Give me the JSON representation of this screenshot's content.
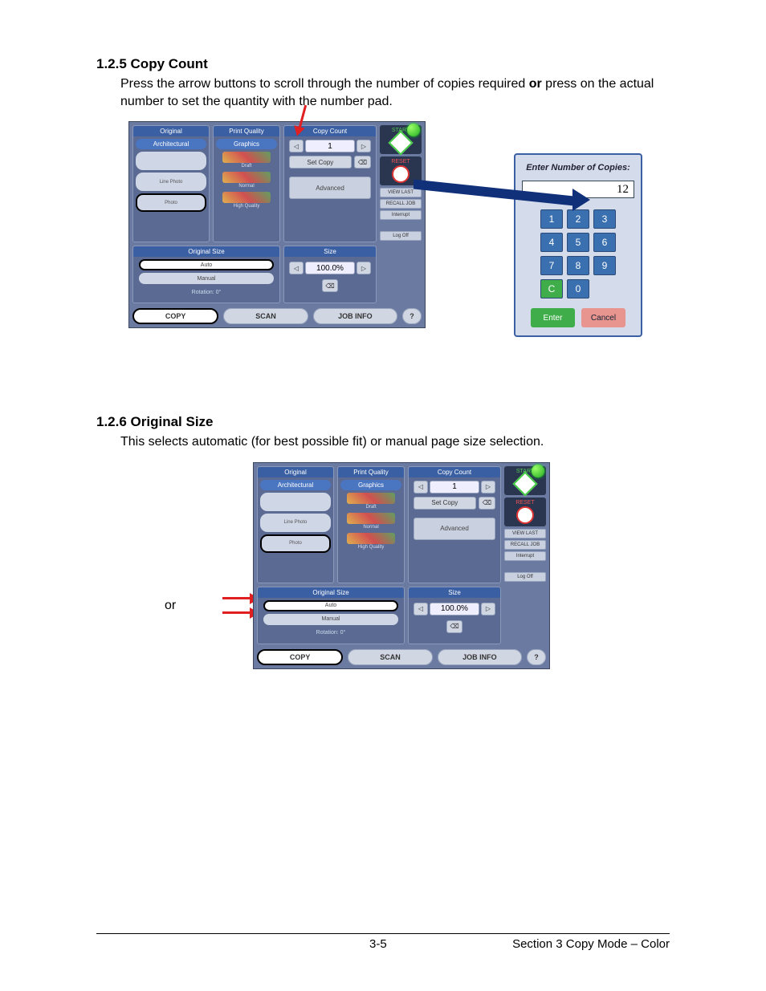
{
  "sections": {
    "copyCount": {
      "heading": "1.2.5   Copy Count",
      "body_pre": "Press the arrow buttons to scroll through the number of copies required ",
      "body_bold": "or",
      "body_post": " press on the actual number to set the quantity with the number pad."
    },
    "originalSize": {
      "heading": "1.2.6   Original Size",
      "body": "This selects automatic (for best possible fit) or manual page size selection.",
      "or_label": "or"
    }
  },
  "panel": {
    "original_header": "Original",
    "original_subtab": "Architectural",
    "original_items": {
      "a": "",
      "b": "Line Photo",
      "c": "Photo"
    },
    "quality_header": "Print Quality",
    "quality_subtab": "Graphics",
    "quality_items": {
      "draft": "Draft",
      "normal": "Normal",
      "high": "High Quality"
    },
    "count_header": "Copy Count",
    "count_value": "1",
    "set_copy": "Set Copy",
    "advanced": "Advanced",
    "osize_header": "Original Size",
    "osize_auto": "Auto",
    "osize_manual": "Manual",
    "osize_rotation": "Rotation: 0°",
    "size_header": "Size",
    "size_value": "100.0%",
    "side": {
      "start": "START",
      "reset": "RESET",
      "viewlast": "VIEW LAST",
      "recall": "RECALL JOB",
      "interrupt": "Interrupt",
      "logoff": "Log Off",
      "help": "?"
    },
    "tabs": {
      "copy": "COPY",
      "scan": "SCAN",
      "jobinfo": "JOB INFO"
    }
  },
  "numpad": {
    "title": "Enter Number of Copies:",
    "display": "12",
    "keys": {
      "k1": "1",
      "k2": "2",
      "k3": "3",
      "k4": "4",
      "k5": "5",
      "k6": "6",
      "k7": "7",
      "k8": "8",
      "k9": "9",
      "kc": "C",
      "k0": "0"
    },
    "enter": "Enter",
    "cancel": "Cancel"
  },
  "glyphs": {
    "left": "◁",
    "right": "▷",
    "eraser": "⌫"
  },
  "footer": {
    "page": "3-5",
    "section": "Section 3     Copy Mode – Color"
  }
}
